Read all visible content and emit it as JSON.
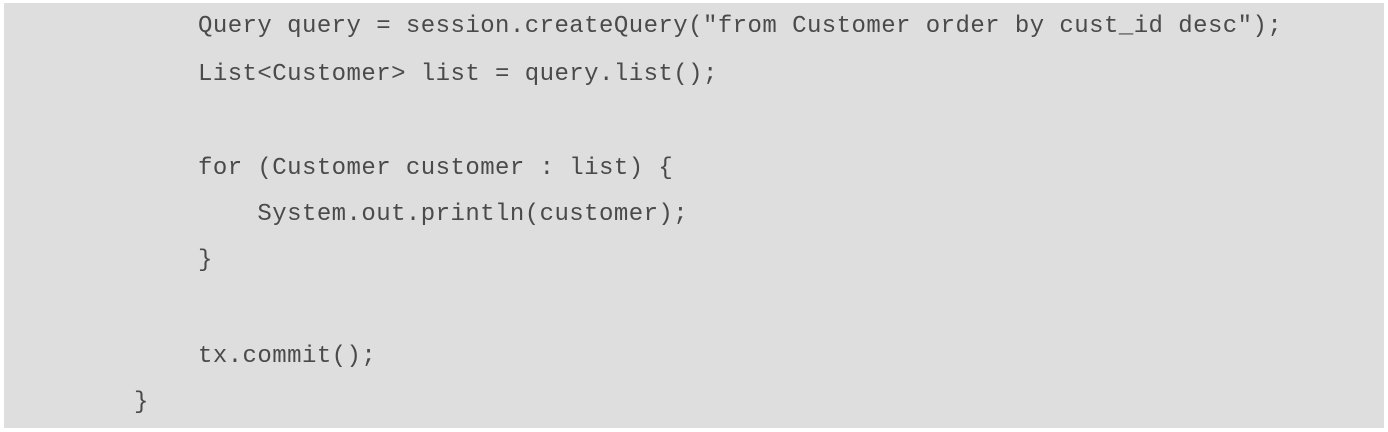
{
  "code": {
    "lines": [
      "Query query = session.createQuery(\"from Customer order by cust_id desc\");",
      "List<Customer> list = query.list();",
      "",
      "for (Customer customer : list) {",
      "    System.out.println(customer);",
      "}",
      "",
      "tx.commit();",
      "}"
    ]
  }
}
